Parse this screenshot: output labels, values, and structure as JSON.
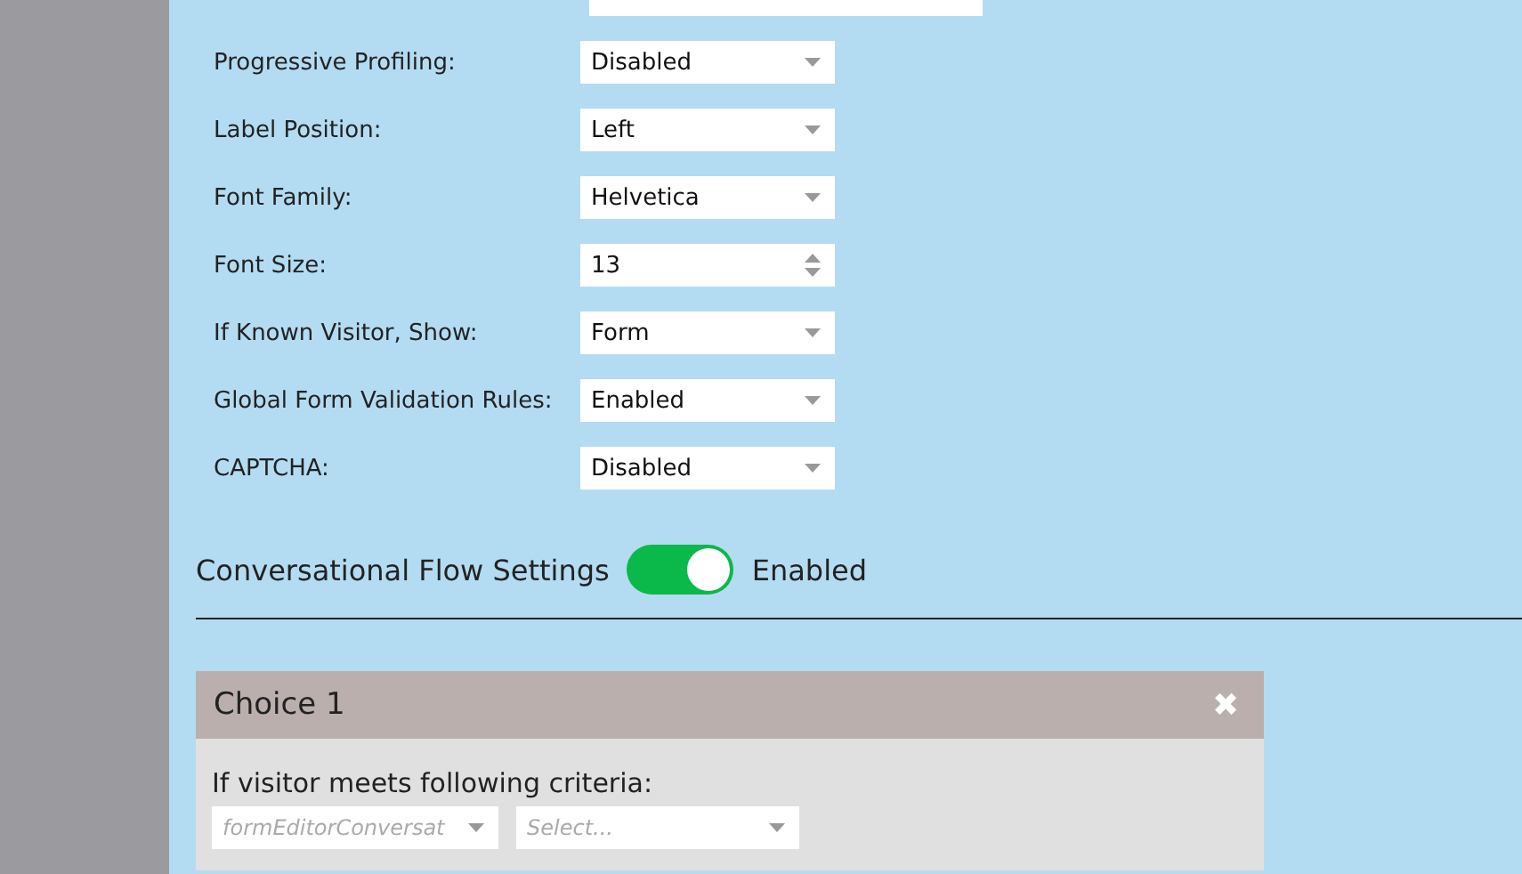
{
  "settings": [
    {
      "label": "Progressive Profiling:",
      "kind": "select",
      "value": "Disabled"
    },
    {
      "label": "Label Position:",
      "kind": "select",
      "value": "Left"
    },
    {
      "label": "Font Family:",
      "kind": "select",
      "value": "Helvetica"
    },
    {
      "label": "Font Size:",
      "kind": "number",
      "value": "13"
    },
    {
      "label": "If Known Visitor, Show:",
      "kind": "select",
      "value": "Form"
    },
    {
      "label": "Global Form Validation Rules:",
      "kind": "select",
      "value": "Enabled"
    },
    {
      "label": "CAPTCHA:",
      "kind": "select",
      "value": "Disabled"
    }
  ],
  "conversational_flow": {
    "label": "Conversational Flow Settings",
    "on": true,
    "status": "Enabled"
  },
  "choice": {
    "title": "Choice 1",
    "close": "✖",
    "criteria_label": "If visitor meets following criteria:",
    "selects": [
      {
        "placeholder": "formEditorConversat"
      },
      {
        "placeholder": "Select..."
      }
    ]
  }
}
